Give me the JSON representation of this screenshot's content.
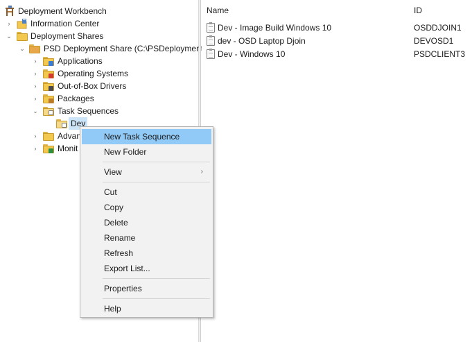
{
  "tree": {
    "root": "Deployment Workbench",
    "information_center": "Information Center",
    "deployment_shares": "Deployment Shares",
    "psd_share": "PSD Deployment Share (C:\\PSDeployment)",
    "applications": "Applications",
    "operating_systems": "Operating Systems",
    "drivers": "Out-of-Box Drivers",
    "packages": "Packages",
    "task_sequences": "Task Sequences",
    "dev": "Dev",
    "advanced_partial": "Advan",
    "monitoring_partial": "Monit"
  },
  "list": {
    "columns": {
      "name": "Name",
      "id": "ID"
    },
    "rows": [
      {
        "name": "Dev - Image Build Windows 10",
        "id": "OSDDJOIN1"
      },
      {
        "name": "dev - OSD Laptop Djoin",
        "id": "DEVOSD1"
      },
      {
        "name": "Dev - Windows 10",
        "id": "PSDCLIENT3"
      }
    ]
  },
  "context_menu": {
    "new_task_sequence": "New Task Sequence",
    "new_folder": "New Folder",
    "view": "View",
    "cut": "Cut",
    "copy": "Copy",
    "delete": "Delete",
    "rename": "Rename",
    "refresh": "Refresh",
    "export_list": "Export List...",
    "properties": "Properties",
    "help": "Help"
  },
  "icons": {
    "workbench": "workbench-icon",
    "folder": "folder-icon",
    "task_sequence": "task-sequence-clipboard-icon",
    "expand": "chevron-right-icon",
    "collapse": "chevron-down-icon",
    "submenu": "submenu-arrow-icon"
  },
  "colors": {
    "highlight": "#91c9f7",
    "tree_selection": "#cce4f7",
    "folder": "#f3c84e"
  }
}
